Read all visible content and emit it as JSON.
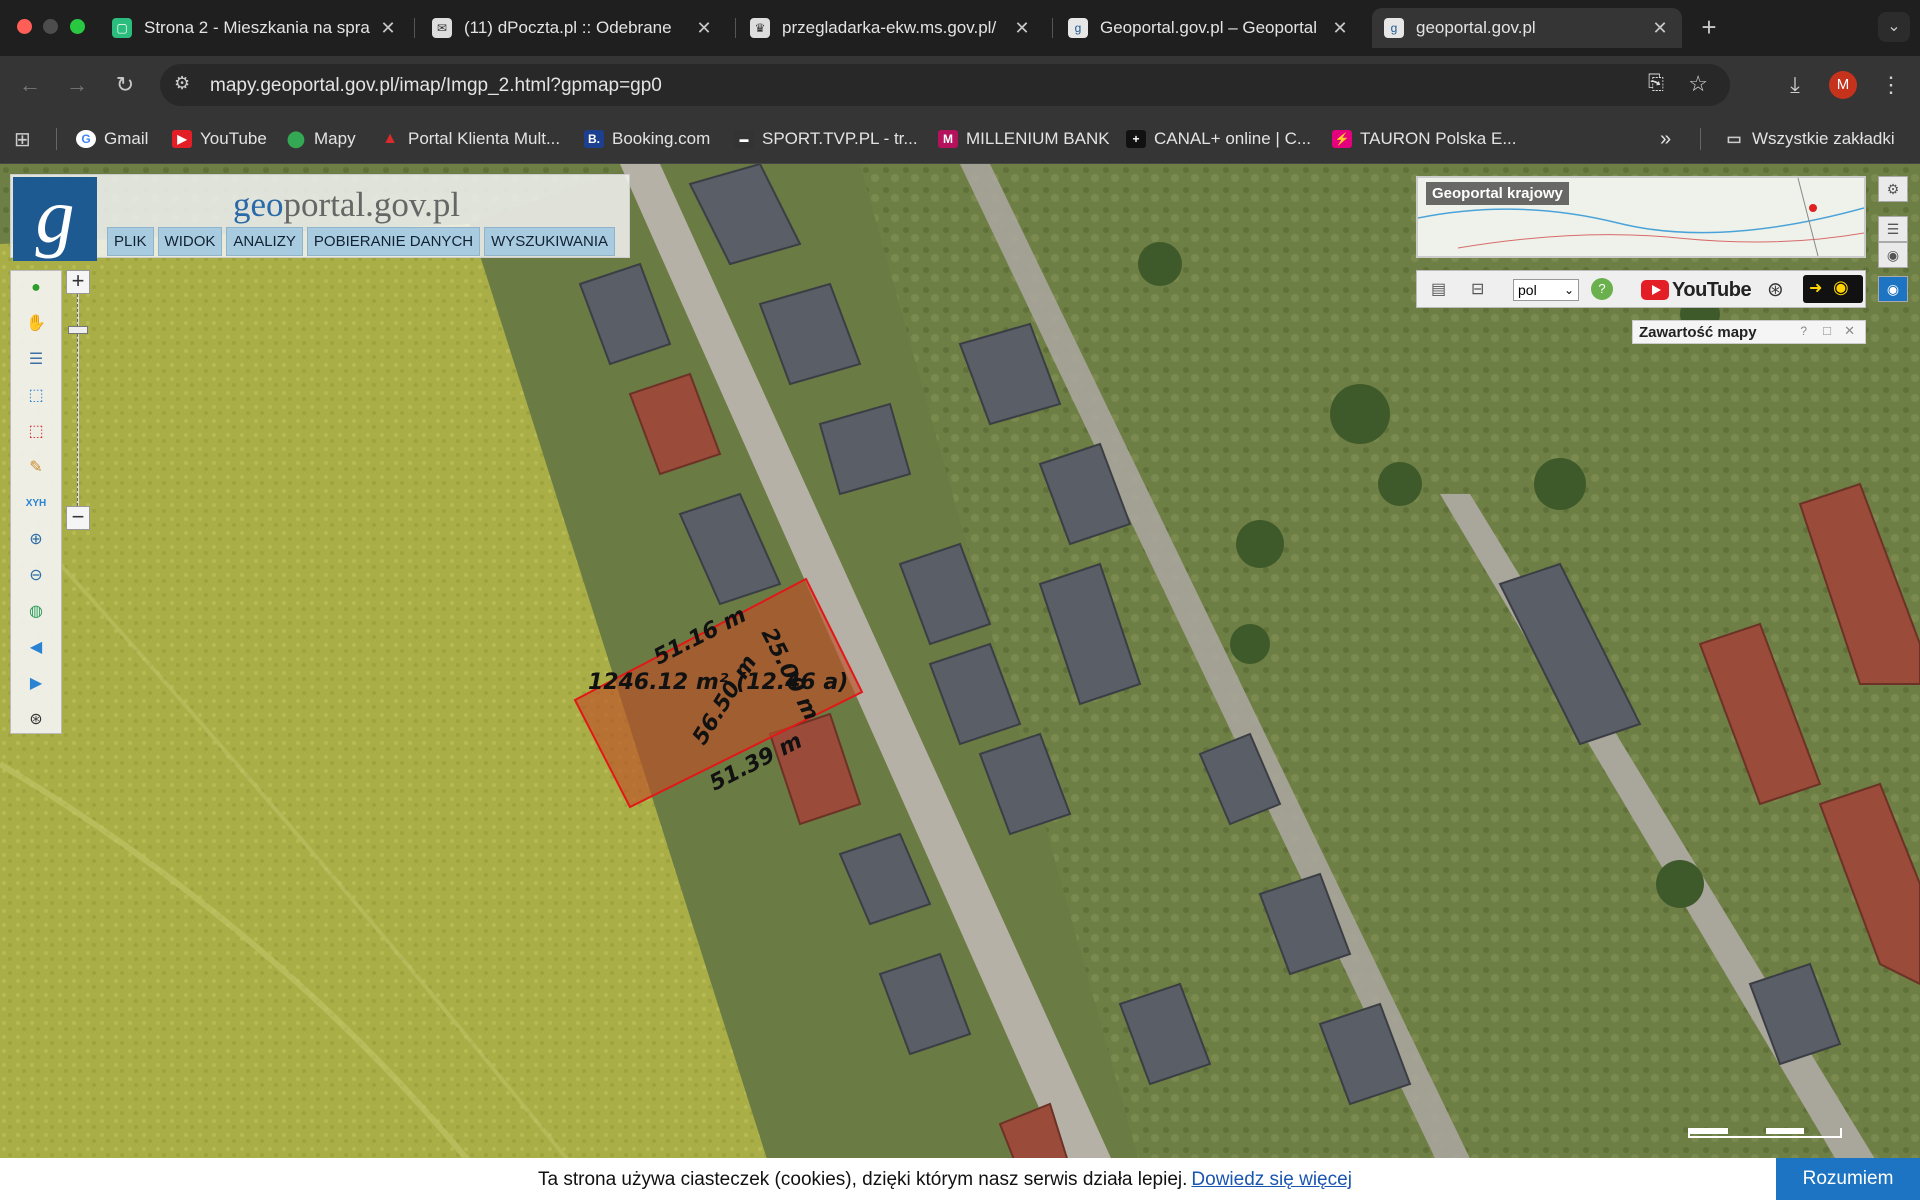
{
  "tabs": [
    {
      "title": "Strona 2 - Mieszkania na spra",
      "favicon": "otodom-icon",
      "color": "#2bbd7e",
      "active": false
    },
    {
      "title": "(11) dPoczta.pl :: Odebrane",
      "favicon": "mail-icon",
      "color": "#e7e7e7",
      "active": false
    },
    {
      "title": "przegladarka-ekw.ms.gov.pl/",
      "favicon": "emblem-icon",
      "color": "#e7e7e7",
      "active": false
    },
    {
      "title": "Geoportal.gov.pl – Geoportal",
      "favicon": "geoportal-icon",
      "color": "#e7e7e7",
      "active": false
    },
    {
      "title": "geoportal.gov.pl",
      "favicon": "geoportal-icon",
      "color": "#e7e7e7",
      "active": true
    }
  ],
  "toolbar": {
    "url": "mapy.geoportal.gov.pl/imap/Imgp_2.html?gpmap=gp0",
    "profile_initial": "M"
  },
  "bookmarks": {
    "items": [
      {
        "label": "Gmail",
        "icon": "google-icon",
        "color": "#ffffff"
      },
      {
        "label": "YouTube",
        "icon": "youtube-icon",
        "color": "#e41e26"
      },
      {
        "label": "Mapy",
        "icon": "maps-pin-icon",
        "color": "#34a853"
      },
      {
        "label": "Portal Klienta Mult...",
        "icon": "portal-icon",
        "color": "#d92b2b"
      },
      {
        "label": "Booking.com",
        "icon": "booking-icon",
        "color": "#1d3f8f"
      },
      {
        "label": "SPORT.TVP.PL - tr...",
        "icon": "tvp-icon",
        "color": "#333333"
      },
      {
        "label": "MILLENIUM BANK",
        "icon": "millenium-icon",
        "color": "#b5125e"
      },
      {
        "label": "CANAL+ online | C...",
        "icon": "canal-icon",
        "color": "#111111"
      },
      {
        "label": "TAURON Polska E...",
        "icon": "tauron-icon",
        "color": "#e5007d"
      }
    ],
    "all_bookmarks": "Wszystkie zakładki"
  },
  "geoportal": {
    "logo_prefix": "geo",
    "logo_rest": "portal.gov.pl",
    "logo_letter": "g",
    "menu": [
      "PLIK",
      "WIDOK",
      "ANALIZY",
      "POBIERANIE DANYCH",
      "WYSZUKIWANIA"
    ],
    "overview_title": "Geoportal krajowy",
    "language": "pol",
    "youtube_label": "YouTube",
    "content_panel_title": "Zawartość mapy"
  },
  "parcel": {
    "side_top": "51.16 m",
    "side_right": "25.00 m",
    "side_bottom": "51.39 m",
    "diagonal": "56.50 m",
    "area": "1246.12 m² (12.46 a)"
  },
  "cookie": {
    "text": "Ta strona używa ciasteczek (cookies), dzięki którym nasz serwis działa lepiej.",
    "link": "Dowiedz się więcej",
    "button": "Rozumiem"
  }
}
